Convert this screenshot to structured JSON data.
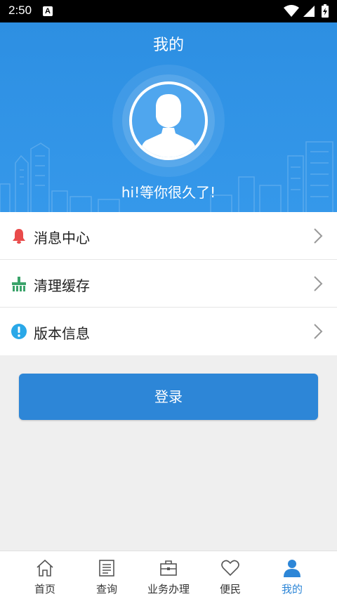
{
  "status_bar": {
    "time": "2:50",
    "notification_badge": "A"
  },
  "header": {
    "title": "我的",
    "greeting": "hi!等你很久了!"
  },
  "menu": [
    {
      "label": "消息中心",
      "icon": "bell-icon"
    },
    {
      "label": "清理缓存",
      "icon": "broom-icon"
    },
    {
      "label": "版本信息",
      "icon": "info-icon"
    }
  ],
  "login": {
    "label": "登录"
  },
  "bottom_nav": [
    {
      "label": "首页",
      "icon": "home-icon"
    },
    {
      "label": "查询",
      "icon": "document-icon"
    },
    {
      "label": "业务办理",
      "icon": "briefcase-icon"
    },
    {
      "label": "便民",
      "icon": "heart-icon"
    },
    {
      "label": "我的",
      "icon": "person-icon",
      "active": true
    }
  ],
  "colors": {
    "header_blue": "#2d8fe2",
    "button_blue": "#2d86d7",
    "bell_red": "#e94b4b",
    "broom_green": "#3aa36a",
    "info_blue": "#2aa8e8"
  }
}
